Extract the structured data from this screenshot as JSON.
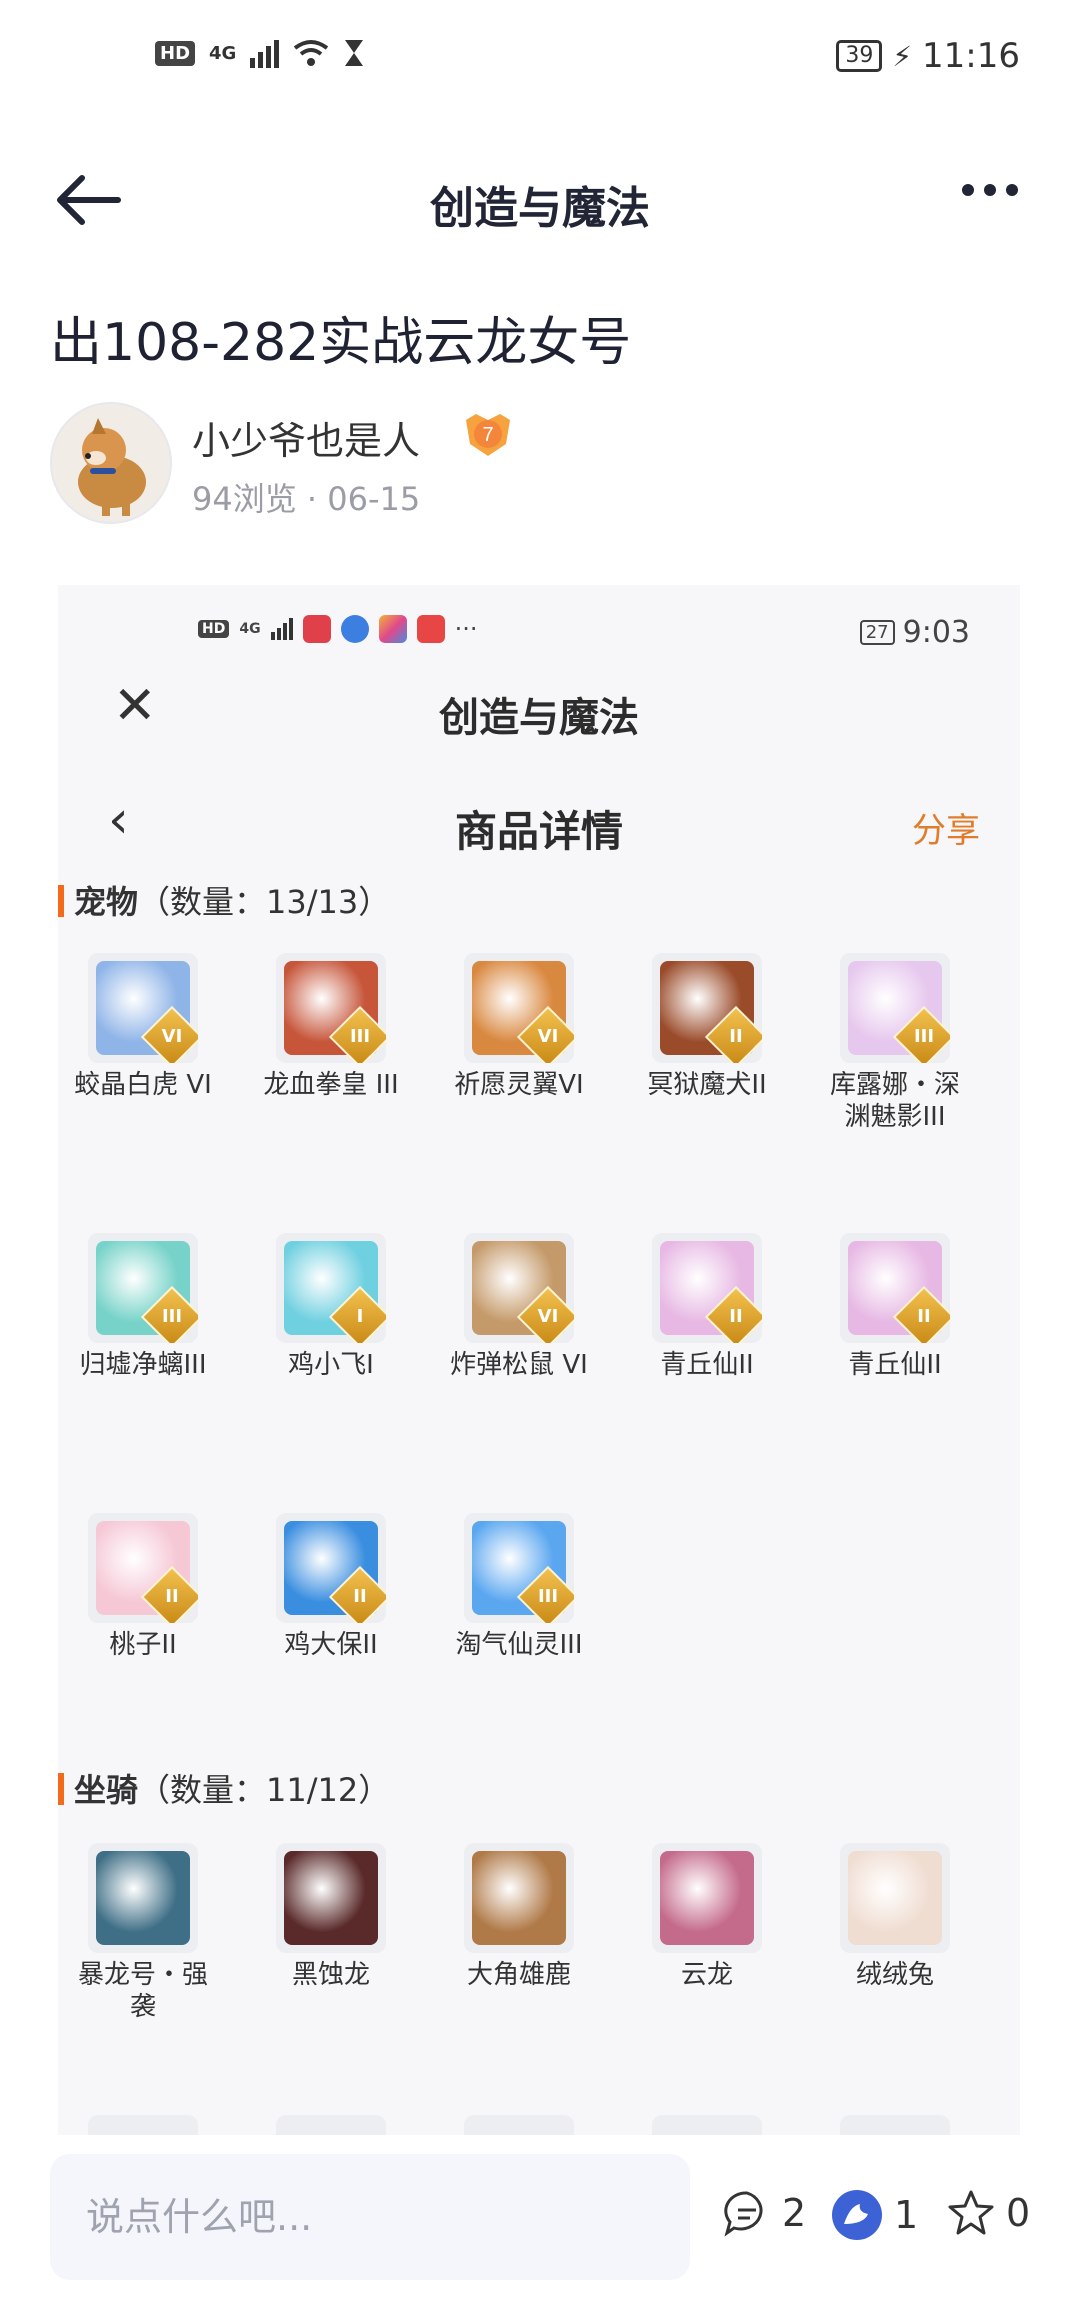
{
  "status_bar": {
    "hd": "HD",
    "network": "4G",
    "time": "11:16",
    "battery": "39"
  },
  "header": {
    "title": "创造与魔法"
  },
  "post": {
    "title": "出108-282实战云龙女号",
    "author": "小少爷也是人",
    "level": "7",
    "meta": "94浏览 · 06-15"
  },
  "screenshot": {
    "status": {
      "hd": "HD",
      "network": "4G",
      "time": "9:03",
      "battery": "27",
      "dots": "···"
    },
    "app_title": "创造与魔法",
    "page_title": "商品详情",
    "share": "分享",
    "pets_section": "宠物",
    "pets_count": "（数量：13/13）",
    "pets": [
      {
        "name": "蛟晶白虎 VI",
        "badge": "VI",
        "color": "#8fb4e8"
      },
      {
        "name": "龙血拳皇 III",
        "badge": "III",
        "color": "#c6553a"
      },
      {
        "name": "祈愿灵翼VI",
        "badge": "VI",
        "color": "#d9883f"
      },
      {
        "name": "冥狱魔犬II",
        "badge": "II",
        "color": "#9a4b2a"
      },
      {
        "name": "库露娜・深渊魅影III",
        "badge": "III",
        "color": "#e6c7ee"
      },
      {
        "name": "归墟净螭III",
        "badge": "III",
        "color": "#77d3c9"
      },
      {
        "name": "鸡小飞I",
        "badge": "I",
        "color": "#6fd0e0"
      },
      {
        "name": "炸弹松鼠 VI",
        "badge": "VI",
        "color": "#c59a6a"
      },
      {
        "name": "青丘仙II",
        "badge": "II",
        "color": "#e7b8e4"
      },
      {
        "name": "青丘仙II",
        "badge": "II",
        "color": "#e7b8e4"
      },
      {
        "name": "桃子II",
        "badge": "II",
        "color": "#f6c8d6"
      },
      {
        "name": "鸡大保II",
        "badge": "II",
        "color": "#3a8ee0"
      },
      {
        "name": "淘气仙灵III",
        "badge": "III",
        "color": "#5aa7f0"
      }
    ],
    "mounts_section": "坐骑",
    "mounts_count": "（数量：11/12）",
    "mounts": [
      {
        "name": "暴龙号・强袭",
        "color": "#3f6f86"
      },
      {
        "name": "黑蚀龙",
        "color": "#5a2a2a"
      },
      {
        "name": "大角雄鹿",
        "color": "#b07a48"
      },
      {
        "name": "云龙",
        "color": "#c46a8a"
      },
      {
        "name": "绒绒兔",
        "color": "#f0ddd2"
      }
    ]
  },
  "bottom": {
    "placeholder": "说点什么吧...",
    "comments": "2",
    "likes": "1",
    "favorites": "0"
  }
}
